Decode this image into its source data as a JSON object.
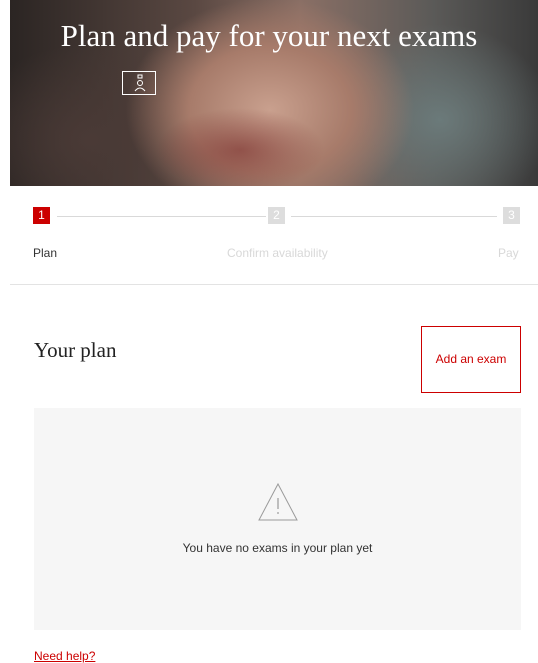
{
  "hero": {
    "title": "Plan and pay for your next exams",
    "badge_icon": "id-badge-icon"
  },
  "stepper": {
    "steps": [
      {
        "number": "1",
        "label": "Plan",
        "active": true
      },
      {
        "number": "2",
        "label": "Confirm availability",
        "active": false
      },
      {
        "number": "3",
        "label": "Pay",
        "active": false
      }
    ],
    "active_color": "#cc0000",
    "inactive_color": "#dddddd"
  },
  "plan": {
    "title": "Your plan",
    "add_button_label": "Add an exam",
    "empty_icon": "warning-triangle-icon",
    "empty_message": "You have no exams in your plan yet"
  },
  "help_link": "Need help?"
}
